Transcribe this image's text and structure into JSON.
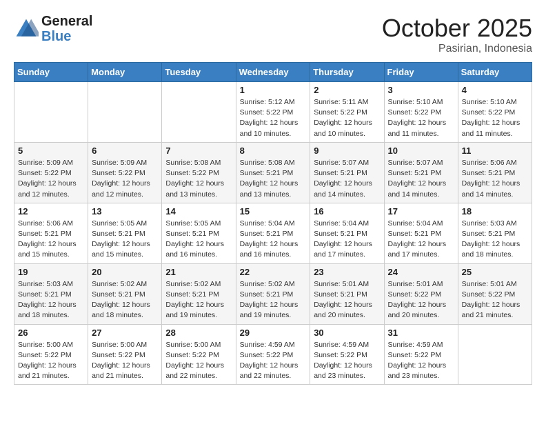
{
  "header": {
    "logo_line1": "General",
    "logo_line2": "Blue",
    "month": "October 2025",
    "location": "Pasirian, Indonesia"
  },
  "days_of_week": [
    "Sunday",
    "Monday",
    "Tuesday",
    "Wednesday",
    "Thursday",
    "Friday",
    "Saturday"
  ],
  "weeks": [
    [
      {
        "day": "",
        "info": ""
      },
      {
        "day": "",
        "info": ""
      },
      {
        "day": "",
        "info": ""
      },
      {
        "day": "1",
        "info": "Sunrise: 5:12 AM\nSunset: 5:22 PM\nDaylight: 12 hours\nand 10 minutes."
      },
      {
        "day": "2",
        "info": "Sunrise: 5:11 AM\nSunset: 5:22 PM\nDaylight: 12 hours\nand 10 minutes."
      },
      {
        "day": "3",
        "info": "Sunrise: 5:10 AM\nSunset: 5:22 PM\nDaylight: 12 hours\nand 11 minutes."
      },
      {
        "day": "4",
        "info": "Sunrise: 5:10 AM\nSunset: 5:22 PM\nDaylight: 12 hours\nand 11 minutes."
      }
    ],
    [
      {
        "day": "5",
        "info": "Sunrise: 5:09 AM\nSunset: 5:22 PM\nDaylight: 12 hours\nand 12 minutes."
      },
      {
        "day": "6",
        "info": "Sunrise: 5:09 AM\nSunset: 5:22 PM\nDaylight: 12 hours\nand 12 minutes."
      },
      {
        "day": "7",
        "info": "Sunrise: 5:08 AM\nSunset: 5:22 PM\nDaylight: 12 hours\nand 13 minutes."
      },
      {
        "day": "8",
        "info": "Sunrise: 5:08 AM\nSunset: 5:21 PM\nDaylight: 12 hours\nand 13 minutes."
      },
      {
        "day": "9",
        "info": "Sunrise: 5:07 AM\nSunset: 5:21 PM\nDaylight: 12 hours\nand 14 minutes."
      },
      {
        "day": "10",
        "info": "Sunrise: 5:07 AM\nSunset: 5:21 PM\nDaylight: 12 hours\nand 14 minutes."
      },
      {
        "day": "11",
        "info": "Sunrise: 5:06 AM\nSunset: 5:21 PM\nDaylight: 12 hours\nand 14 minutes."
      }
    ],
    [
      {
        "day": "12",
        "info": "Sunrise: 5:06 AM\nSunset: 5:21 PM\nDaylight: 12 hours\nand 15 minutes."
      },
      {
        "day": "13",
        "info": "Sunrise: 5:05 AM\nSunset: 5:21 PM\nDaylight: 12 hours\nand 15 minutes."
      },
      {
        "day": "14",
        "info": "Sunrise: 5:05 AM\nSunset: 5:21 PM\nDaylight: 12 hours\nand 16 minutes."
      },
      {
        "day": "15",
        "info": "Sunrise: 5:04 AM\nSunset: 5:21 PM\nDaylight: 12 hours\nand 16 minutes."
      },
      {
        "day": "16",
        "info": "Sunrise: 5:04 AM\nSunset: 5:21 PM\nDaylight: 12 hours\nand 17 minutes."
      },
      {
        "day": "17",
        "info": "Sunrise: 5:04 AM\nSunset: 5:21 PM\nDaylight: 12 hours\nand 17 minutes."
      },
      {
        "day": "18",
        "info": "Sunrise: 5:03 AM\nSunset: 5:21 PM\nDaylight: 12 hours\nand 18 minutes."
      }
    ],
    [
      {
        "day": "19",
        "info": "Sunrise: 5:03 AM\nSunset: 5:21 PM\nDaylight: 12 hours\nand 18 minutes."
      },
      {
        "day": "20",
        "info": "Sunrise: 5:02 AM\nSunset: 5:21 PM\nDaylight: 12 hours\nand 18 minutes."
      },
      {
        "day": "21",
        "info": "Sunrise: 5:02 AM\nSunset: 5:21 PM\nDaylight: 12 hours\nand 19 minutes."
      },
      {
        "day": "22",
        "info": "Sunrise: 5:02 AM\nSunset: 5:21 PM\nDaylight: 12 hours\nand 19 minutes."
      },
      {
        "day": "23",
        "info": "Sunrise: 5:01 AM\nSunset: 5:21 PM\nDaylight: 12 hours\nand 20 minutes."
      },
      {
        "day": "24",
        "info": "Sunrise: 5:01 AM\nSunset: 5:22 PM\nDaylight: 12 hours\nand 20 minutes."
      },
      {
        "day": "25",
        "info": "Sunrise: 5:01 AM\nSunset: 5:22 PM\nDaylight: 12 hours\nand 21 minutes."
      }
    ],
    [
      {
        "day": "26",
        "info": "Sunrise: 5:00 AM\nSunset: 5:22 PM\nDaylight: 12 hours\nand 21 minutes."
      },
      {
        "day": "27",
        "info": "Sunrise: 5:00 AM\nSunset: 5:22 PM\nDaylight: 12 hours\nand 21 minutes."
      },
      {
        "day": "28",
        "info": "Sunrise: 5:00 AM\nSunset: 5:22 PM\nDaylight: 12 hours\nand 22 minutes."
      },
      {
        "day": "29",
        "info": "Sunrise: 4:59 AM\nSunset: 5:22 PM\nDaylight: 12 hours\nand 22 minutes."
      },
      {
        "day": "30",
        "info": "Sunrise: 4:59 AM\nSunset: 5:22 PM\nDaylight: 12 hours\nand 23 minutes."
      },
      {
        "day": "31",
        "info": "Sunrise: 4:59 AM\nSunset: 5:22 PM\nDaylight: 12 hours\nand 23 minutes."
      },
      {
        "day": "",
        "info": ""
      }
    ]
  ]
}
